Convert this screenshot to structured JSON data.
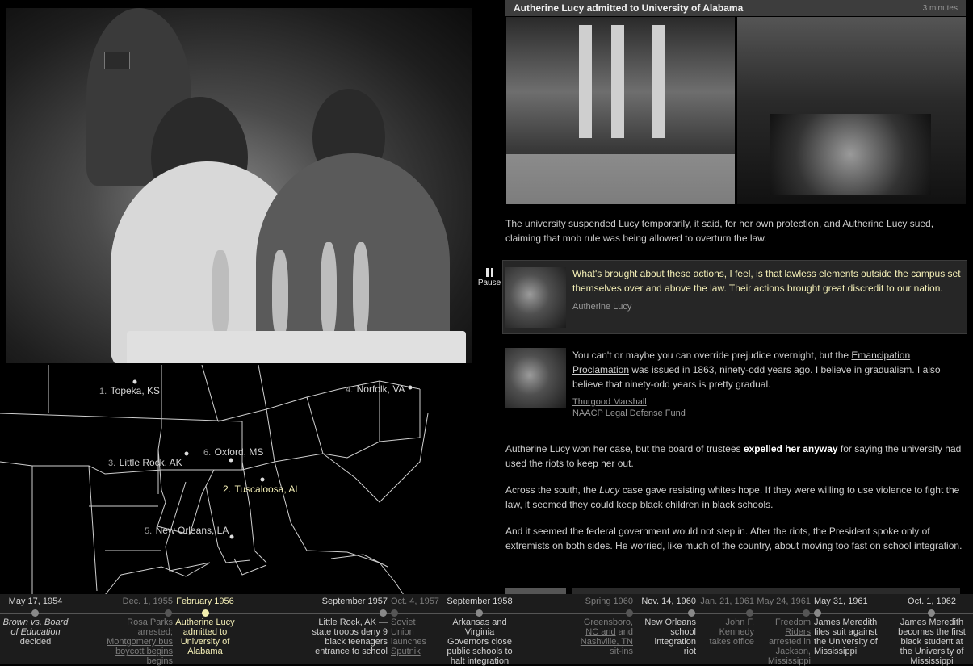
{
  "article": {
    "title": "Autherine Lucy admitted to University of Alabama",
    "duration": "3 minutes",
    "para1": "The university suspended Lucy temporarily, it said, for her own protection, and Autherine Lucy sued, claiming that mob rule was being allowed to overturn the law.",
    "quote1": {
      "text": "What's brought about these actions, I feel, is that lawless elements outside the campus set themselves over and above the law. Their actions brought great discredit to our nation.",
      "author": "Autherine Lucy"
    },
    "quote2": {
      "text_before": "You can't or maybe you can override prejudice overnight, but the ",
      "link": "Emancipation Proclamation",
      "text_after": " was issued in 1863, ninety-odd years ago. I believe in gradualism. I also believe that ninety-odd years is pretty gradual.",
      "author": "Thurgood Marshall",
      "org": "NAACP Legal Defense Fund"
    },
    "para2_before": "Autherine Lucy won her case, but the board of trustees ",
    "para2_bold": "expelled her anyway",
    "para2_after": " for saying the university had used the riots to keep her out.",
    "para3_before": "Across the south, the ",
    "para3_italic": "Lucy",
    "para3_after": " case gave resisting whites hope. If they were willing to use violence to fight the law, it seemed they could keep black children in black schools.",
    "para4": "And it seemed the federal government would not step in. After the riots, the President spoke only of extremists on both sides. He worried, like much of the country, about moving too fast on school integration."
  },
  "pause_label": "Pause",
  "map": {
    "locations": [
      {
        "num": "1.",
        "name": "Topeka, KS"
      },
      {
        "num": "2.",
        "name": "Tuscaloosa, AL"
      },
      {
        "num": "3.",
        "name": "Little Rock, AK"
      },
      {
        "num": "4.",
        "name": "Norfolk, VA"
      },
      {
        "num": "5.",
        "name": "New Orleans, LA"
      },
      {
        "num": "6.",
        "name": "Oxford, MS"
      }
    ]
  },
  "timeline": [
    {
      "date": "May 17, 1954",
      "lines": [
        "Brown vs. Board",
        "of Education",
        "decided"
      ]
    },
    {
      "date": "Dec. 1, 1955",
      "lines": [
        "Rosa Parks",
        "arrested;",
        "Montgomery bus",
        "boycott begins"
      ]
    },
    {
      "date": "February 1956",
      "lines": [
        "Autherine Lucy",
        "admitted to",
        "University of",
        "Alabama"
      ]
    },
    {
      "date": "September 1957",
      "lines": [
        "Little Rock, AK —",
        "state troops deny 9",
        "black teenagers",
        "entrance to school"
      ]
    },
    {
      "date": "Oct. 4, 1957",
      "lines": [
        "Soviet",
        "Union",
        "launches",
        "Sputnik"
      ]
    },
    {
      "date": "September 1958",
      "lines": [
        "Arkansas and",
        "Virginia",
        "Governors close",
        "public schools to",
        "halt integration"
      ]
    },
    {
      "date": "Spring 1960",
      "lines": [
        "Greensboro,",
        "NC and",
        "Nashville, TN",
        "sit-ins"
      ]
    },
    {
      "date": "Nov. 14, 1960",
      "lines": [
        "New Orleans",
        "school",
        "integration",
        "riot"
      ]
    },
    {
      "date": "Jan. 21, 1961",
      "lines": [
        "John F.",
        "Kennedy",
        "takes office"
      ]
    },
    {
      "date": "May 24, 1961",
      "lines": [
        "Freedom",
        "Riders",
        "arrested in",
        "Jackson,",
        "Mississippi"
      ]
    },
    {
      "date": "May 31, 1961",
      "lines": [
        "James Meredith",
        "files suit against",
        "the University of",
        "Mississippi"
      ]
    },
    {
      "date": "Oct. 1, 1962",
      "lines": [
        "James Meredith",
        "becomes the first",
        "black student at",
        "the University of",
        "Mississippi"
      ]
    }
  ]
}
